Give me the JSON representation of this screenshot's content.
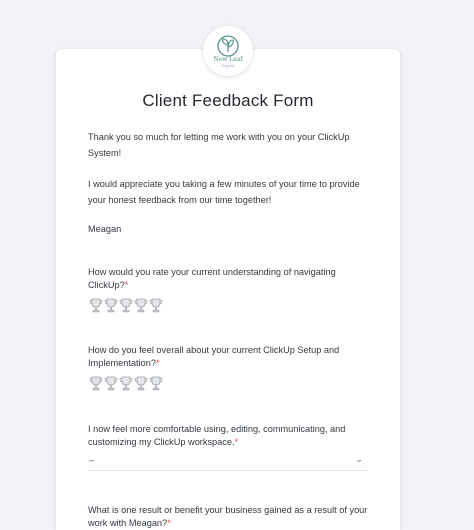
{
  "logo": {
    "text": "New Leaf",
    "subtext": "Digital"
  },
  "form": {
    "title": "Client Feedback Form",
    "intro_1": "Thank you so much for letting me work with you on your ClickUp System!",
    "intro_2": "I would appreciate you taking a few minutes of your time to provide your honest feedback from our time together!",
    "signature": "Meagan"
  },
  "questions": [
    {
      "text": "How would you rate your current understanding of navigating ClickUp?",
      "required_mark": "*",
      "type": "rating",
      "max": 5
    },
    {
      "text": "How do you feel overall about your current ClickUp Setup and Implementation?",
      "required_mark": "*",
      "type": "rating",
      "max": 5
    },
    {
      "text": "I now feel more comfortable using, editing, communicating, and customizing my ClickUp workspace.",
      "required_mark": "*",
      "type": "dropdown",
      "value": "–",
      "caret": "⌄"
    },
    {
      "text": "What is one result or benefit your business gained as a result of your work with Meagan?",
      "required_mark": "*",
      "type": "text"
    }
  ],
  "colors": {
    "required": "#e5484d",
    "trophy": "#b9bcc2",
    "logo_leaf": "#4f8f8b"
  }
}
